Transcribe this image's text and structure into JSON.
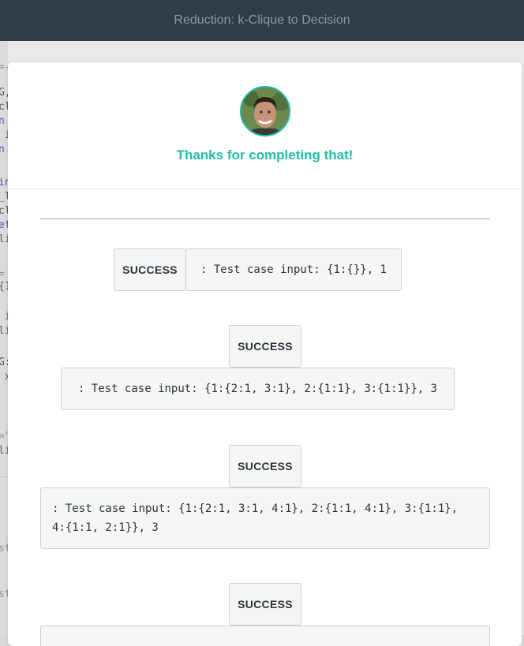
{
  "app": {
    "title": "Reduction: k-Clique to Decision"
  },
  "editor_fragments": [
    "=-",
    "G,",
    "cl",
    "n",
    " i",
    "n",
    "in",
    "_l",
    "cl",
    "et",
    "li",
    "=",
    "{1",
    " i",
    "li",
    "G:",
    " x",
    "=\"",
    "li",
    "st",
    "st"
  ],
  "modal": {
    "message": "Thanks for completing that!",
    "results": [
      {
        "status": "SUCCESS",
        "detail": ": Test case input: {1:{}}, 1"
      },
      {
        "status": "SUCCESS",
        "detail": ": Test case input: {1:{2:1, 3:1}, 2:{1:1}, 3:{1:1}}, 3"
      },
      {
        "status": "SUCCESS",
        "detail": ": Test case input: {1:{2:1, 3:1, 4:1}, 2:{1:1, 4:1}, 3:{1:1},\n4:{1:1, 2:1}}, 3"
      },
      {
        "status": "SUCCESS",
        "detail": ""
      }
    ]
  },
  "colors": {
    "accent": "#1ebfa8",
    "topbar": "#2e3d48"
  }
}
